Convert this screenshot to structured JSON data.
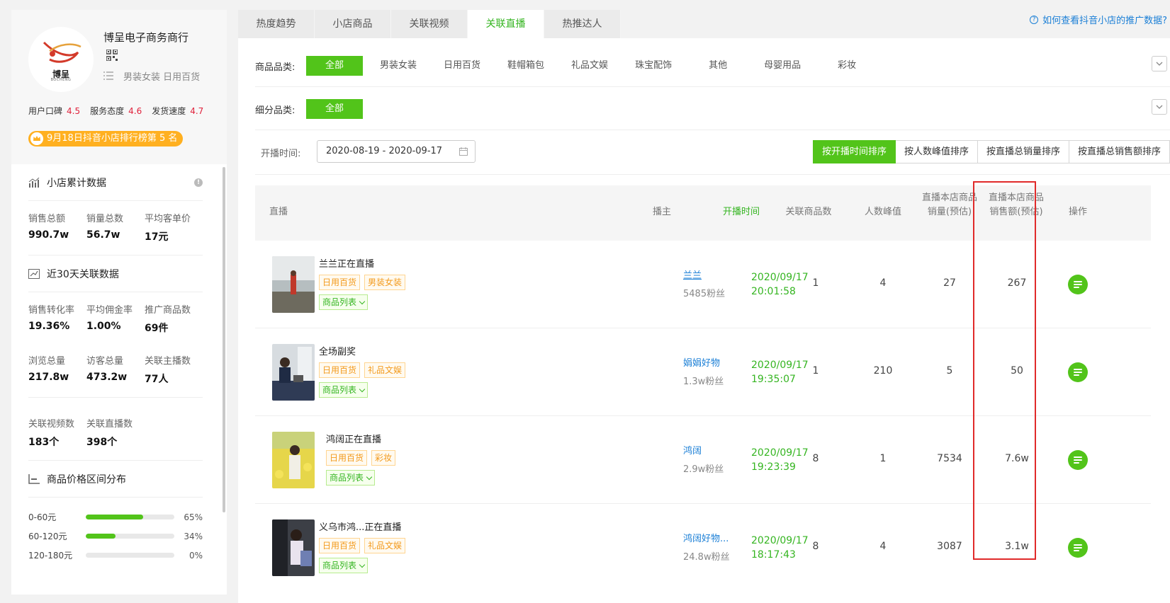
{
  "shop": {
    "name": "博呈电子商务商行",
    "logo_text": "博呈",
    "logo_sub": "BOCHENG",
    "categories": "男装女装 日用百货",
    "ratings": [
      {
        "label": "用户口碑",
        "value": "4.5"
      },
      {
        "label": "服务态度",
        "value": "4.6"
      },
      {
        "label": "发货速度",
        "value": "4.7"
      }
    ],
    "rank_badge": "9月18日抖音小店排行榜第 5 名"
  },
  "cumulative": {
    "title": "小店累计数据",
    "stats": [
      {
        "label": "销售总额",
        "value": "990.7w"
      },
      {
        "label": "销量总数",
        "value": "56.7w"
      },
      {
        "label": "平均客单价",
        "value": "17元"
      }
    ]
  },
  "recent30": {
    "title": "近30天关联数据",
    "row1": [
      {
        "label": "销售转化率",
        "value": "19.36%"
      },
      {
        "label": "平均佣金率",
        "value": "1.00%"
      },
      {
        "label": "推广商品数",
        "value": "69件"
      }
    ],
    "row2": [
      {
        "label": "浏览总量",
        "value": "217.8w"
      },
      {
        "label": "访客总量",
        "value": "473.2w"
      },
      {
        "label": "关联主播数",
        "value": "77人"
      }
    ],
    "row3": [
      {
        "label": "关联视频数",
        "value": "183个"
      },
      {
        "label": "关联直播数",
        "value": "398个"
      }
    ]
  },
  "price_dist": {
    "title": "商品价格区间分布",
    "rows": [
      {
        "label": "0-60元",
        "percent": 65,
        "text": "65%"
      },
      {
        "label": "60-120元",
        "percent": 34,
        "text": "34%"
      },
      {
        "label": "120-180元",
        "percent": 0,
        "text": "0%"
      }
    ]
  },
  "tabs": [
    {
      "label": "热度趋势",
      "active": false
    },
    {
      "label": "小店商品",
      "active": false
    },
    {
      "label": "关联视频",
      "active": false
    },
    {
      "label": "关联直播",
      "active": true
    },
    {
      "label": "热推达人",
      "active": false
    }
  ],
  "help_link": "如何查看抖音小店的推广数据?",
  "filters": {
    "category_label": "商品品类:",
    "categories": [
      "全部",
      "男装女装",
      "日用百货",
      "鞋帽箱包",
      "礼品文娱",
      "珠宝配饰",
      "其他",
      "母婴用品",
      "彩妆"
    ],
    "sub_label": "细分品类:",
    "sub_categories": [
      "全部"
    ]
  },
  "date": {
    "label": "开播时间:",
    "value": "2020-08-19 - 2020-09-17"
  },
  "sort_buttons": [
    {
      "label": "按开播时间排序",
      "active": true
    },
    {
      "label": "按人数峰值排序",
      "active": false
    },
    {
      "label": "按直播总销量排序",
      "active": false
    },
    {
      "label": "按直播总销售额排序",
      "active": false
    }
  ],
  "table": {
    "headers": {
      "live": "直播",
      "anchor": "播主",
      "start": "开播时间",
      "goods_count": "关联商品数",
      "peak": "人数峰值",
      "sales_vol": "直播本店商品销量(预估)",
      "sales_amt": "直播本店商品销售额(预估)",
      "op": "操作"
    },
    "goods_list_label": "商品列表",
    "rows": [
      {
        "title": "兰兰正在直播",
        "tags": [
          "日用百货",
          "男装女装"
        ],
        "anchor": "兰兰",
        "fans": "5485粉丝",
        "start": "2020/09/17\n20:01:58",
        "goods_count": "1",
        "peak": "4",
        "sales_vol": "27",
        "sales_amt": "267"
      },
      {
        "title": "全场副奖",
        "tags": [
          "日用百货",
          "礼品文娱"
        ],
        "anchor": "娟娟好物",
        "fans": "1.3w粉丝",
        "start": "2020/09/17\n19:35:07",
        "goods_count": "1",
        "peak": "210",
        "sales_vol": "5",
        "sales_amt": "50"
      },
      {
        "title": "鸿阔正在直播",
        "tags": [
          "日用百货",
          "彩妆"
        ],
        "anchor": "鸿阔",
        "fans": "2.9w粉丝",
        "start": "2020/09/17\n19:23:39",
        "goods_count": "8",
        "peak": "1",
        "sales_vol": "7534",
        "sales_amt": "7.6w"
      },
      {
        "title": "义乌市鸿...正在直播",
        "tags": [
          "日用百货",
          "礼品文娱"
        ],
        "anchor": "鸿阔好物...",
        "fans": "24.8w粉丝",
        "start": "2020/09/17\n18:17:43",
        "goods_count": "8",
        "peak": "4",
        "sales_vol": "3087",
        "sales_amt": "3.1w"
      }
    ]
  },
  "colors": {
    "accent": "#52c41a",
    "link": "#1b7fd6",
    "rating": "#e0223c",
    "badge": "#ffb020",
    "highlight": "#e02a2a"
  }
}
